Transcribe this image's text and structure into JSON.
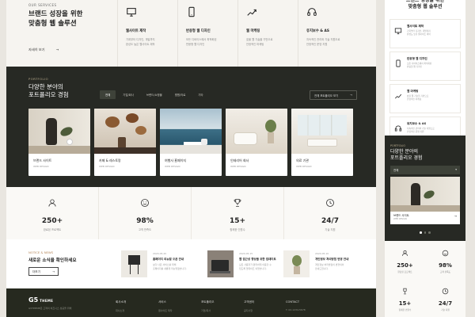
{
  "hero": {
    "section_label": "OUR SERVICES",
    "title": "브랜드 성장을 위한\n맞춤형 웹 솔루션",
    "more_label": "자세히 보기",
    "services": [
      {
        "icon": "monitor-icon",
        "name": "웹사이트 제작",
        "desc": "기획부터 디자인, 개발까지\n완성도 높은 웹사이트 제작"
      },
      {
        "icon": "mobile-icon",
        "name": "반응형 웹 디자인",
        "desc": "모든 디바이스에서 최적화된\n반응형 웹 디자인"
      },
      {
        "icon": "chart-icon",
        "name": "웹 마케팅",
        "desc": "효율 웹 기술을 기반으로\n안정적인 마케팅"
      },
      {
        "icon": "headset-icon",
        "name": "유지보수 & AS",
        "desc": "지속적인 관리와 기술 지원으로\n안정적인 운영 지원"
      }
    ]
  },
  "portfolio": {
    "label": "PORTFOLIO",
    "title": "다양한 분야의\n포트폴리오 경험",
    "tabs": [
      "전체",
      "기업/회사",
      "브랜드/쇼핑몰",
      "병원/의료",
      "기타"
    ],
    "all_button": "전체 포트폴리오 보기",
    "cards": [
      {
        "name": "브랜드 사이트",
        "category": "WEB DESIGN"
      },
      {
        "name": "카페 & 레스토랑",
        "category": "WEB DESIGN"
      },
      {
        "name": "여행사 홈페이지",
        "category": "WEB DESIGN"
      },
      {
        "name": "인테리어 회사",
        "category": "WEB DESIGN"
      },
      {
        "name": "의료 기관",
        "category": "WEB DESIGN"
      }
    ]
  },
  "stats": [
    {
      "icon": "user-icon",
      "value": "250+",
      "label": "완료된 프로젝트"
    },
    {
      "icon": "smile-icon",
      "value": "98%",
      "label": "고객 만족도"
    },
    {
      "icon": "trophy-icon",
      "value": "15+",
      "label": "함께한 인원수"
    },
    {
      "icon": "clock-icon",
      "value": "24/7",
      "label": "기술 지원"
    }
  ],
  "news": {
    "label": "NOTICE & NEWS",
    "title": "새로운 소식을 확인하세요",
    "button": "더보기",
    "items": [
      {
        "date": "2024.05.20",
        "title": "홈페이지 리뉴얼 오픈 안내",
        "desc": "보다 나은 서비스를 위해\n홈페이지를 새롭게 리뉴얼했습니다."
      },
      {
        "date": "2024.05.15",
        "title": "웹 접근성 향상을 위한 업데이트",
        "desc": "모든 사용자가 편리하게 이용할 수\n있도록 업데이트 되었습니다."
      },
      {
        "date": "2024.05.10",
        "title": "개인정보 처리방침 변경 안내",
        "desc": "개인정보 처리방침이 변경되어\n안내드립니다."
      }
    ]
  },
  "footer": {
    "logo": "G5",
    "logo_suffix": "THEME",
    "desc": "G5THEME은 고객의 비즈니스 성공을 위해",
    "cols": [
      {
        "head": "회사소개",
        "item": "회사소개"
      },
      {
        "head": "서비스",
        "item": "웹사이트 제작"
      },
      {
        "head": "포트폴리오",
        "item": "기업/회사"
      },
      {
        "head": "고객센터",
        "item": "공지사항"
      },
      {
        "head": "CONTACT",
        "item": "T. 02-1234-5678"
      }
    ]
  },
  "mobile": {
    "title": "브랜드 성장을 위한\n맞춤형 웹 솔루션",
    "services": [
      {
        "icon": "monitor-icon",
        "name": "웹사이트 제작",
        "desc": "기획부터 디자인, 개발까지\n완성도 높은 웹사이트 제작"
      },
      {
        "icon": "mobile-icon",
        "name": "반응형 웹 디자인",
        "desc": "모든 디바이스에서 최적화된\n반응형 웹 디자인"
      },
      {
        "icon": "chart-icon",
        "name": "웹 마케팅",
        "desc": "효율 웹 기술을 기반으로\n안정적인 마케팅"
      },
      {
        "icon": "headset-icon",
        "name": "유지보수 & AS",
        "desc": "지속적인 관리와 기술 지원으로\n안정적인 운영 지원"
      }
    ],
    "portfolio_label": "PORTFOLIO",
    "portfolio_title": "다양한 분야의\n포트폴리오 경험",
    "select_value": "전체",
    "card_name": "브랜드 사이트",
    "card_category": "WEB DESIGN",
    "stats": [
      {
        "value": "250+",
        "label": "완료된 프로젝트"
      },
      {
        "value": "98%",
        "label": "고객 만족도"
      },
      {
        "value": "15+",
        "label": "함께한 인원수"
      },
      {
        "value": "24/7",
        "label": "기술 지원"
      }
    ]
  },
  "colors": {
    "dark": "#272924",
    "accent": "#b7a98c",
    "bg": "#f6f4f0"
  }
}
